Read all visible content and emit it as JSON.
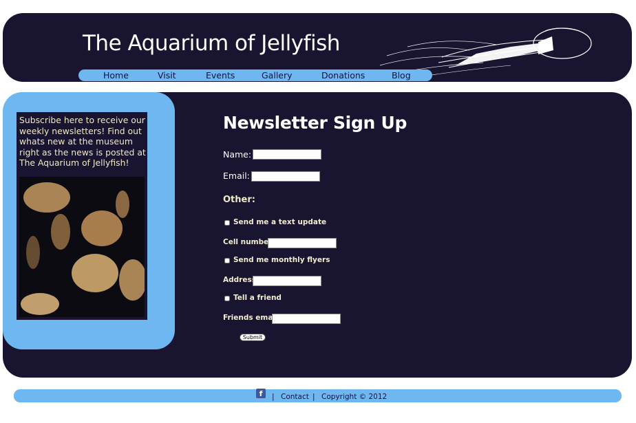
{
  "header": {
    "title": "The Aquarium of Jellyfish",
    "nav": [
      {
        "label": "Home"
      },
      {
        "label": "Visit"
      },
      {
        "label": "Events"
      },
      {
        "label": "Gallery"
      },
      {
        "label": "Donations"
      },
      {
        "label": "Blog"
      }
    ]
  },
  "sidebar": {
    "text": " Subscribe here to receive our weekly newsletters! Find out whats new at the museum right as the news is posted at The Aquarium of Jellyfish!",
    "photo_icon": "jellyfish-photo"
  },
  "form": {
    "title": "Newsletter Sign Up",
    "name_label": "Name:",
    "email_label": "Email:",
    "other_label": "Other:",
    "text_update_label": "Send me a text update",
    "cell_label": "Cell number:",
    "flyers_label": "Send me monthly flyers",
    "address_label": "Address:",
    "friend_label": "Tell a friend",
    "friends_email_label": "Friends email:",
    "submit_label": "Submit"
  },
  "footer": {
    "fb_icon": "f",
    "sep1": "|",
    "contact": "Contact",
    "sep2": "|",
    "copyright": "Copyright © 2012"
  },
  "colors": {
    "dark": "#191530",
    "accent": "#6fb7f0",
    "cream": "#f0e8c8"
  }
}
